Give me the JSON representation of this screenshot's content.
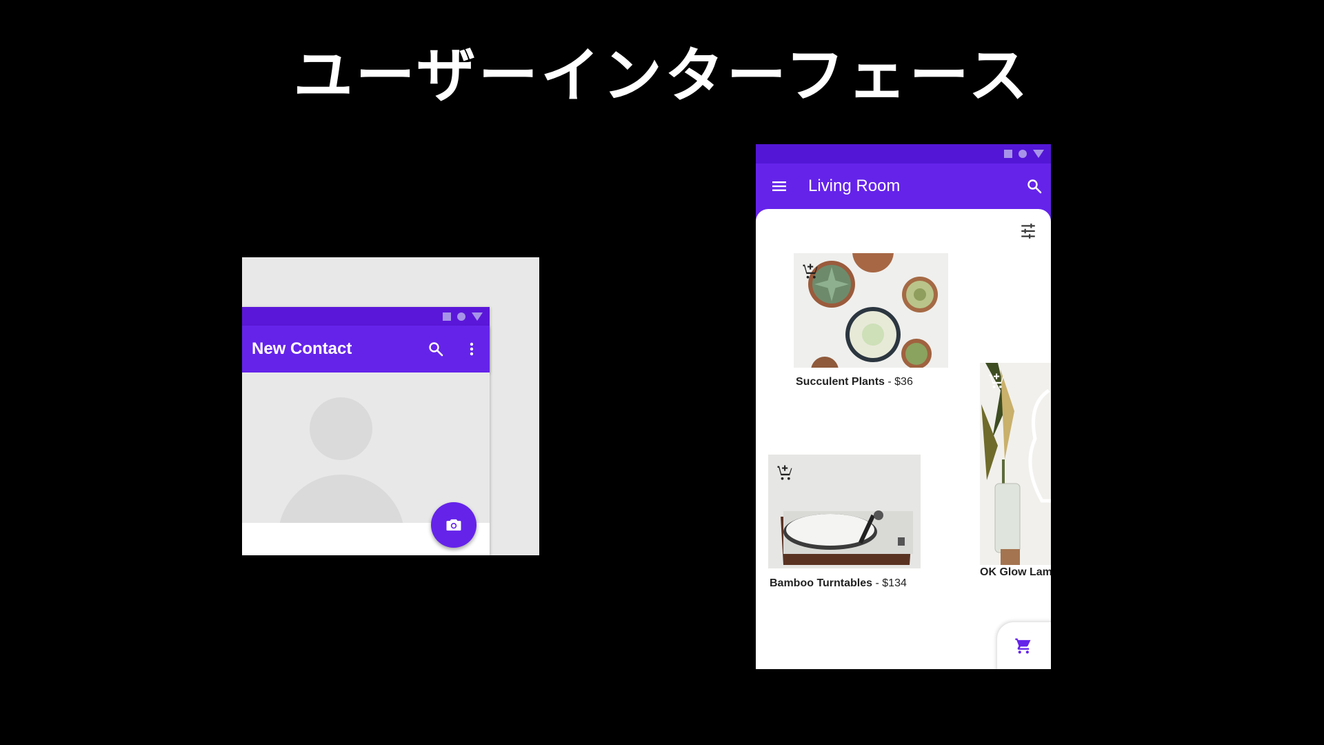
{
  "slide": {
    "title": "ユーザーインターフェース"
  },
  "contact_app": {
    "title": "New Contact",
    "icons": [
      "search-icon",
      "more-vert-icon",
      "camera-icon"
    ],
    "accent": "#6523ea"
  },
  "shop_app": {
    "title": "Living Room",
    "icons": [
      "menu-icon",
      "search-icon",
      "tune-icon",
      "shopping-cart-icon"
    ],
    "accent": "#6523ea",
    "products": [
      {
        "name": "Succulent Plants",
        "price": "$36"
      },
      {
        "name": "Bamboo Turntables",
        "price": "$134"
      },
      {
        "name": "OK Glow Lamp",
        "price": ""
      }
    ],
    "lamp_label": "OK Glow Lam"
  }
}
